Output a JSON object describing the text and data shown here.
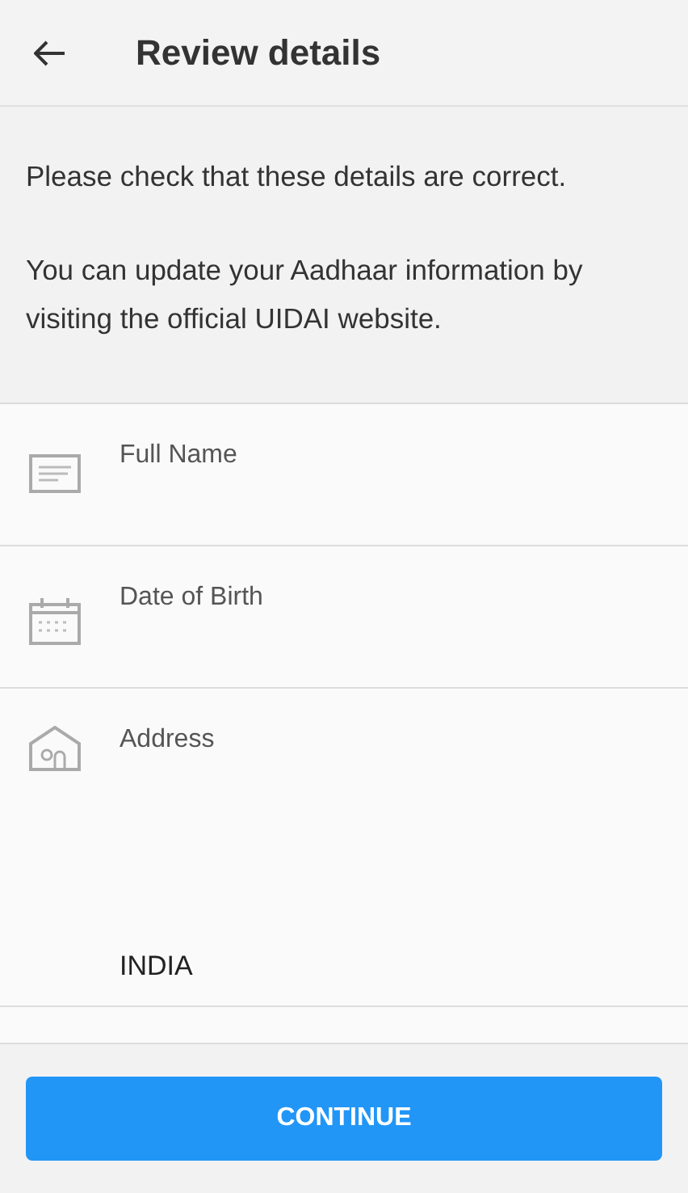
{
  "header": {
    "title": "Review details"
  },
  "intro": [
    "Please check that these details are correct.",
    "You can update your Aadhaar information by visiting the official UIDAI website."
  ],
  "fields": [
    {
      "kind": "name",
      "label": "Full Name"
    },
    {
      "kind": "date",
      "label": "Date of Birth"
    },
    {
      "kind": "address",
      "label": "Address",
      "value": "INDIA"
    }
  ],
  "button": {
    "label": "CONTINUE"
  }
}
